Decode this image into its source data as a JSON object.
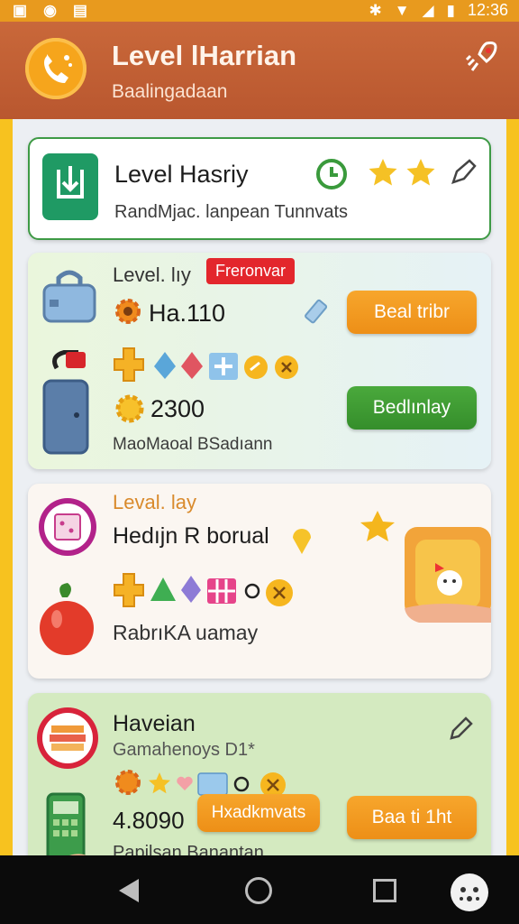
{
  "status_bar": {
    "time": "12:36"
  },
  "app_bar": {
    "title": "Level lHarrian",
    "subtitle": "Baalingadaan"
  },
  "card1": {
    "title": "Level Hasriy",
    "subtitle": "RandMjac. lanpean Tunnvats"
  },
  "card2": {
    "label": "Level. lıy",
    "badge": "Freronvar",
    "value1": "Ha.110",
    "button1": "Beal tribr",
    "value2": "2300",
    "button2": "Bedlınlay",
    "footer": "MaoMaoal BSadıann"
  },
  "card3": {
    "label": "Leval. lay",
    "title": "Hedıjn R borual",
    "footer": "RabrıKA uamay"
  },
  "card4": {
    "title": "Haveian",
    "subtitle": "Gamahenoys D1*",
    "value": "4.8090",
    "tag": "Hxadkmvats",
    "button": "Baa ti 1ht",
    "footer": "Papilsan Banantan"
  }
}
